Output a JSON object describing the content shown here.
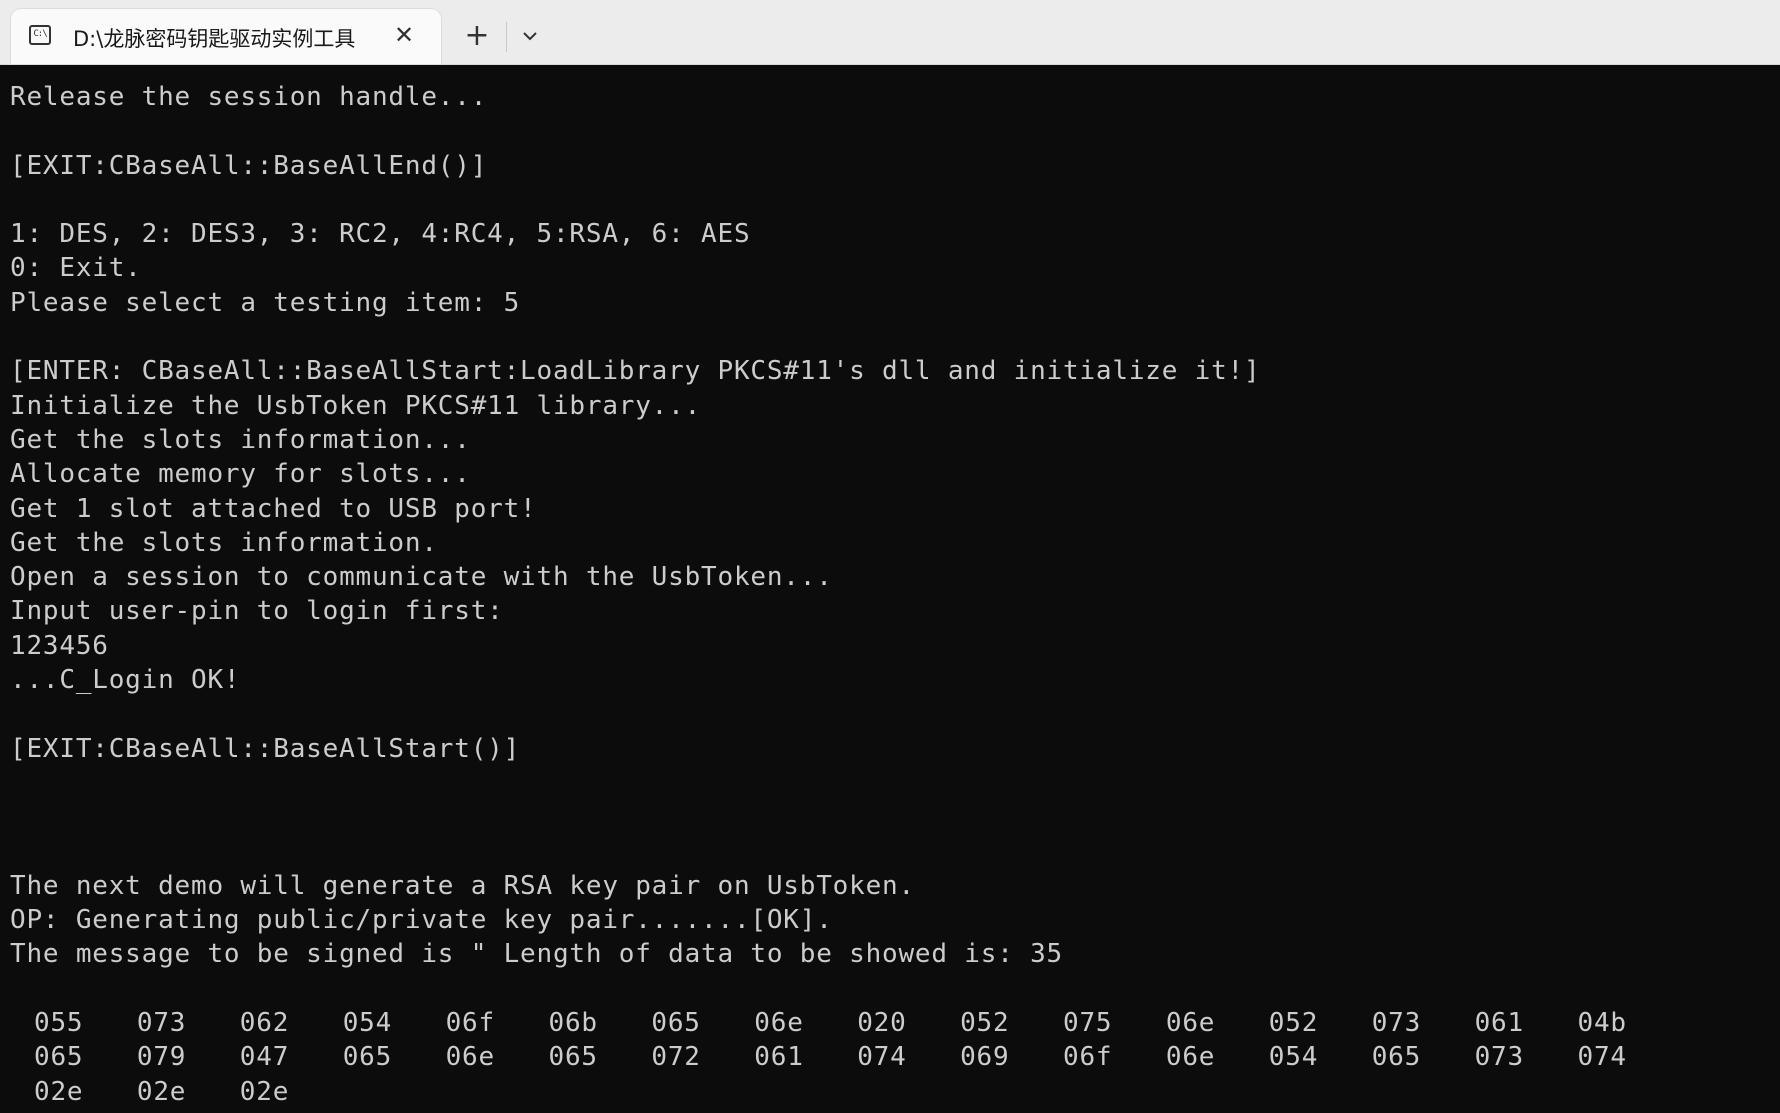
{
  "tab": {
    "icon_label": "C:\\",
    "title": "D:\\龙脉密码钥匙驱动实例工具",
    "close_symbol": "✕",
    "new_tab_symbol": "+"
  },
  "terminal": {
    "lines": [
      "Release the session handle...",
      "",
      "[EXIT:CBaseAll::BaseAllEnd()]",
      "",
      "1: DES, 2: DES3, 3: RC2, 4:RC4, 5:RSA, 6: AES",
      "0: Exit.",
      "Please select a testing item: 5",
      "",
      "[ENTER: CBaseAll::BaseAllStart:LoadLibrary PKCS#11's dll and initialize it!]",
      "Initialize the UsbToken PKCS#11 library...",
      "Get the slots information...",
      "Allocate memory for slots...",
      "Get 1 slot attached to USB port!",
      "Get the slots information.",
      "Open a session to communicate with the UsbToken...",
      "Input user-pin to login first:",
      "123456",
      "...C_Login OK!",
      "",
      "[EXIT:CBaseAll::BaseAllStart()]",
      "",
      "",
      "",
      "The next demo will generate a RSA key pair on UsbToken.",
      "OP: Generating public/private key pair.......[OK].",
      "The message to be signed is \" Length of data to be showed is: 35",
      ""
    ],
    "hex_rows": [
      [
        "055",
        "073",
        "062",
        "054",
        "06f",
        "06b",
        "065",
        "06e",
        "020",
        "052",
        "075",
        "06e",
        "052",
        "073",
        "061",
        "04b"
      ],
      [
        "065",
        "079",
        "047",
        "065",
        "06e",
        "065",
        "072",
        "061",
        "074",
        "069",
        "06f",
        "06e",
        "054",
        "065",
        "073",
        "074"
      ],
      [
        "02e",
        "02e",
        "02e"
      ]
    ]
  }
}
